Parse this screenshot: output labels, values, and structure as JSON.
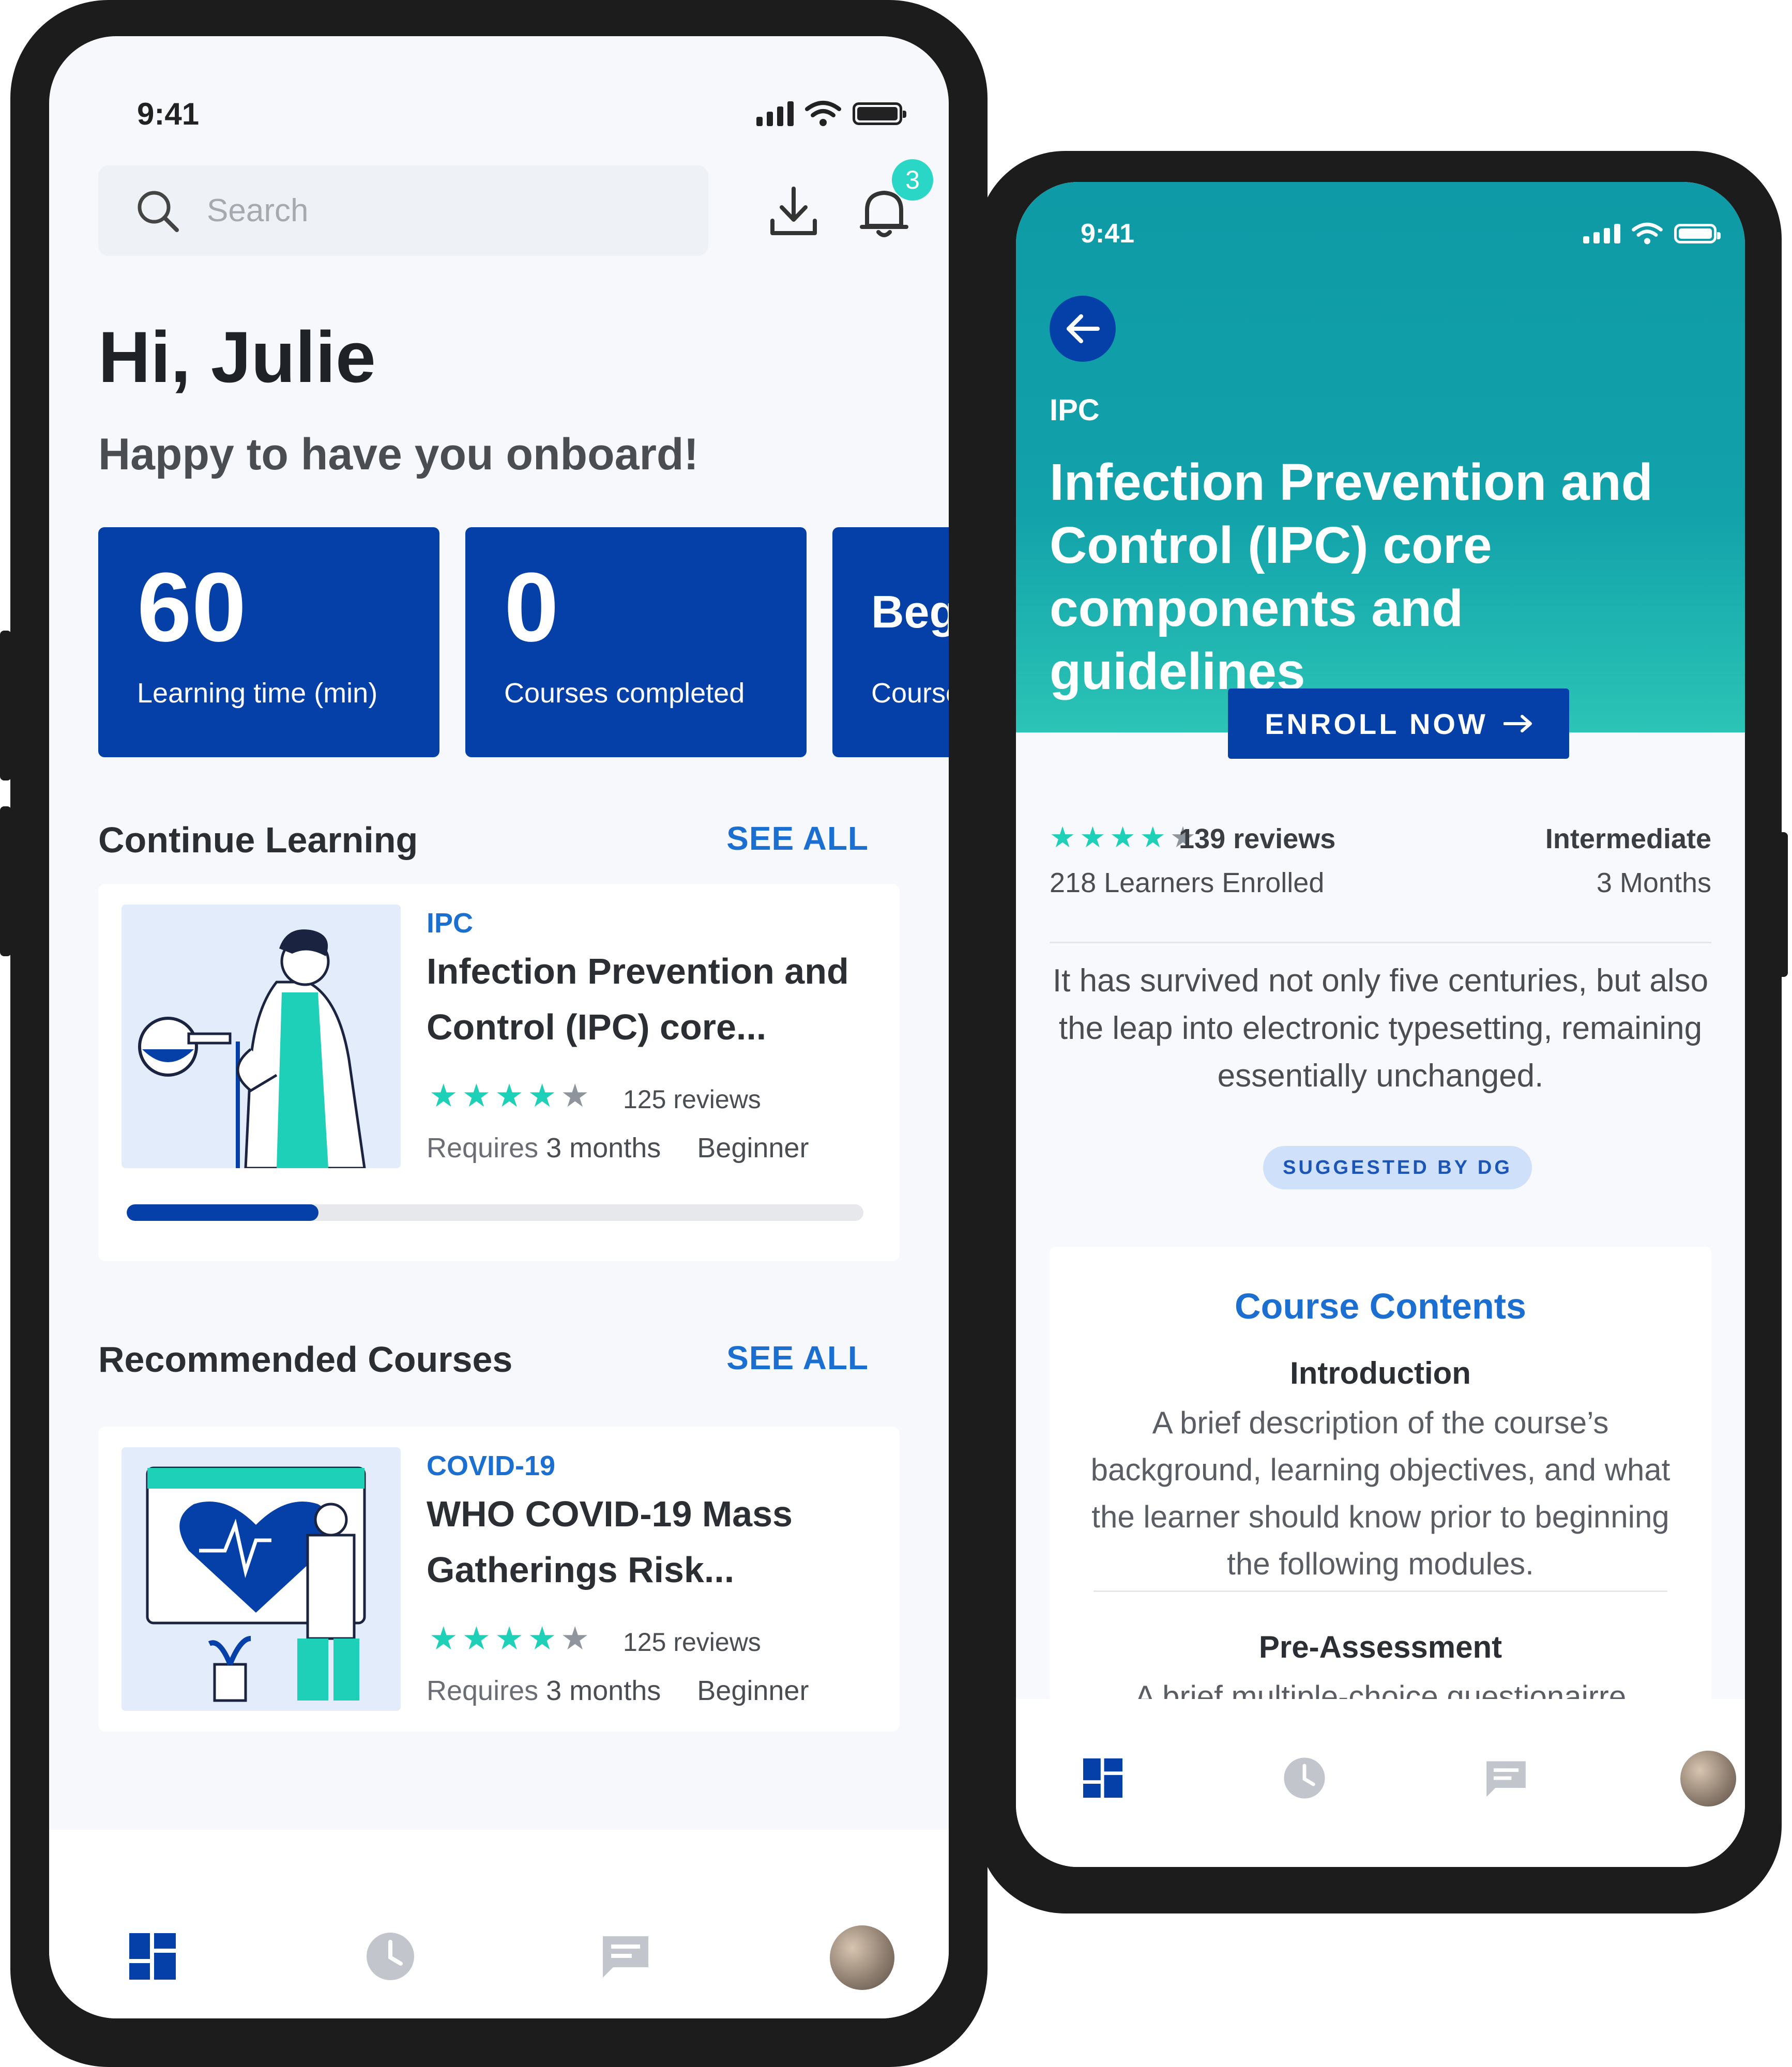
{
  "colors": {
    "primary": "#0540a8",
    "accent_teal": "#1fd0b8",
    "link_blue": "#1b6fd1",
    "hero_teal": "#0e9aa6"
  },
  "left": {
    "status_time": "9:41",
    "search_placeholder": "Search",
    "notification_count": "3",
    "greeting": "Hi, Julie",
    "subtitle": "Happy to have you onboard!",
    "stats": [
      {
        "value": "60",
        "label": "Learning time (min)"
      },
      {
        "value": "0",
        "label": "Courses completed"
      },
      {
        "value": "Beg",
        "label": "Course"
      }
    ],
    "continue": {
      "title": "Continue Learning",
      "see_all": "SEE ALL",
      "card": {
        "category": "IPC",
        "title_line1": "Infection Prevention and",
        "title_line2": "Control (IPC) core...",
        "rating": 4,
        "reviews": "125 reviews",
        "requires": "Requires",
        "duration": "3 months",
        "level": "Beginner",
        "progress": 0.26
      }
    },
    "recommended": {
      "title": "Recommended Courses",
      "see_all": "SEE ALL",
      "card": {
        "category": "COVID-19",
        "title_line1": "WHO COVID-19 Mass",
        "title_line2": "Gatherings Risk...",
        "rating": 4,
        "reviews": "125 reviews",
        "requires": "Requires",
        "duration": "3 months",
        "level": "Beginner"
      }
    }
  },
  "right": {
    "status_time": "9:41",
    "category": "IPC",
    "title": "Infection Prevention and Control (IPC) core components and guidelines",
    "enroll_label": "ENROLL NOW",
    "rating": 4,
    "reviews": "139 reviews",
    "learners": "218 Learners Enrolled",
    "level": "Intermediate",
    "duration": "3 Months",
    "description": "It has survived not only five centuries, but also the leap into electronic typesetting, remaining essentially unchanged.",
    "suggested": "SUGGESTED BY DG",
    "contents": {
      "title": "Course Contents",
      "items": [
        {
          "heading": "Introduction",
          "text": "A brief description of the course’s background, learning objectives, and what the learner should know prior to beginning the following modules."
        },
        {
          "heading": "Pre-Assessment",
          "text": "A brief multiple-choice questionairre"
        }
      ]
    }
  }
}
